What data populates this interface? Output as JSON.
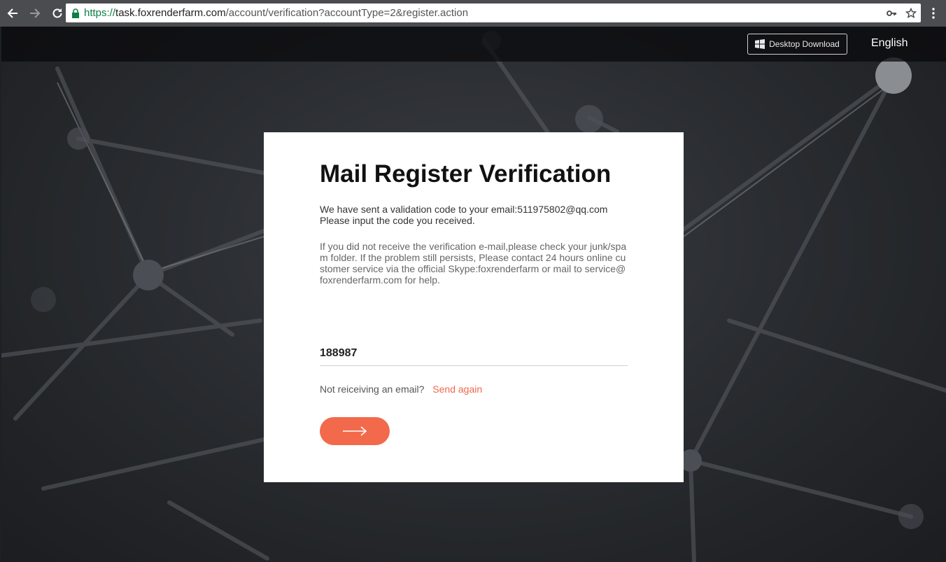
{
  "browser": {
    "url_scheme": "https://",
    "url_host": "task.foxrenderfarm.com",
    "url_path": "/account/verification?accountType=2&register.action",
    "icons": [
      "back-icon",
      "forward-icon",
      "reload-icon",
      "lock-icon",
      "key-icon",
      "star-icon",
      "menu-icon"
    ]
  },
  "header": {
    "download_label": "Desktop Download",
    "language": "English"
  },
  "card": {
    "title": "Mail Register Verification",
    "sent_line1": "We have sent a validation code to your email:511975802@qq.com",
    "sent_line2": "Please input the code you received.",
    "help_text": "If you did not receive the verification e-mail,please check your junk/spam folder. If the problem still persists, Please contact 24 hours online customer service via the official Skype:foxrenderfarm or mail to service@foxrenderfarm.com for help.",
    "code_value": "188987",
    "resend_question": "Not reiceiving an email?",
    "resend_link": "Send again"
  },
  "colors": {
    "accent": "#f26a4b",
    "link": "#f0684a",
    "chrome": "#4a4c4f"
  }
}
